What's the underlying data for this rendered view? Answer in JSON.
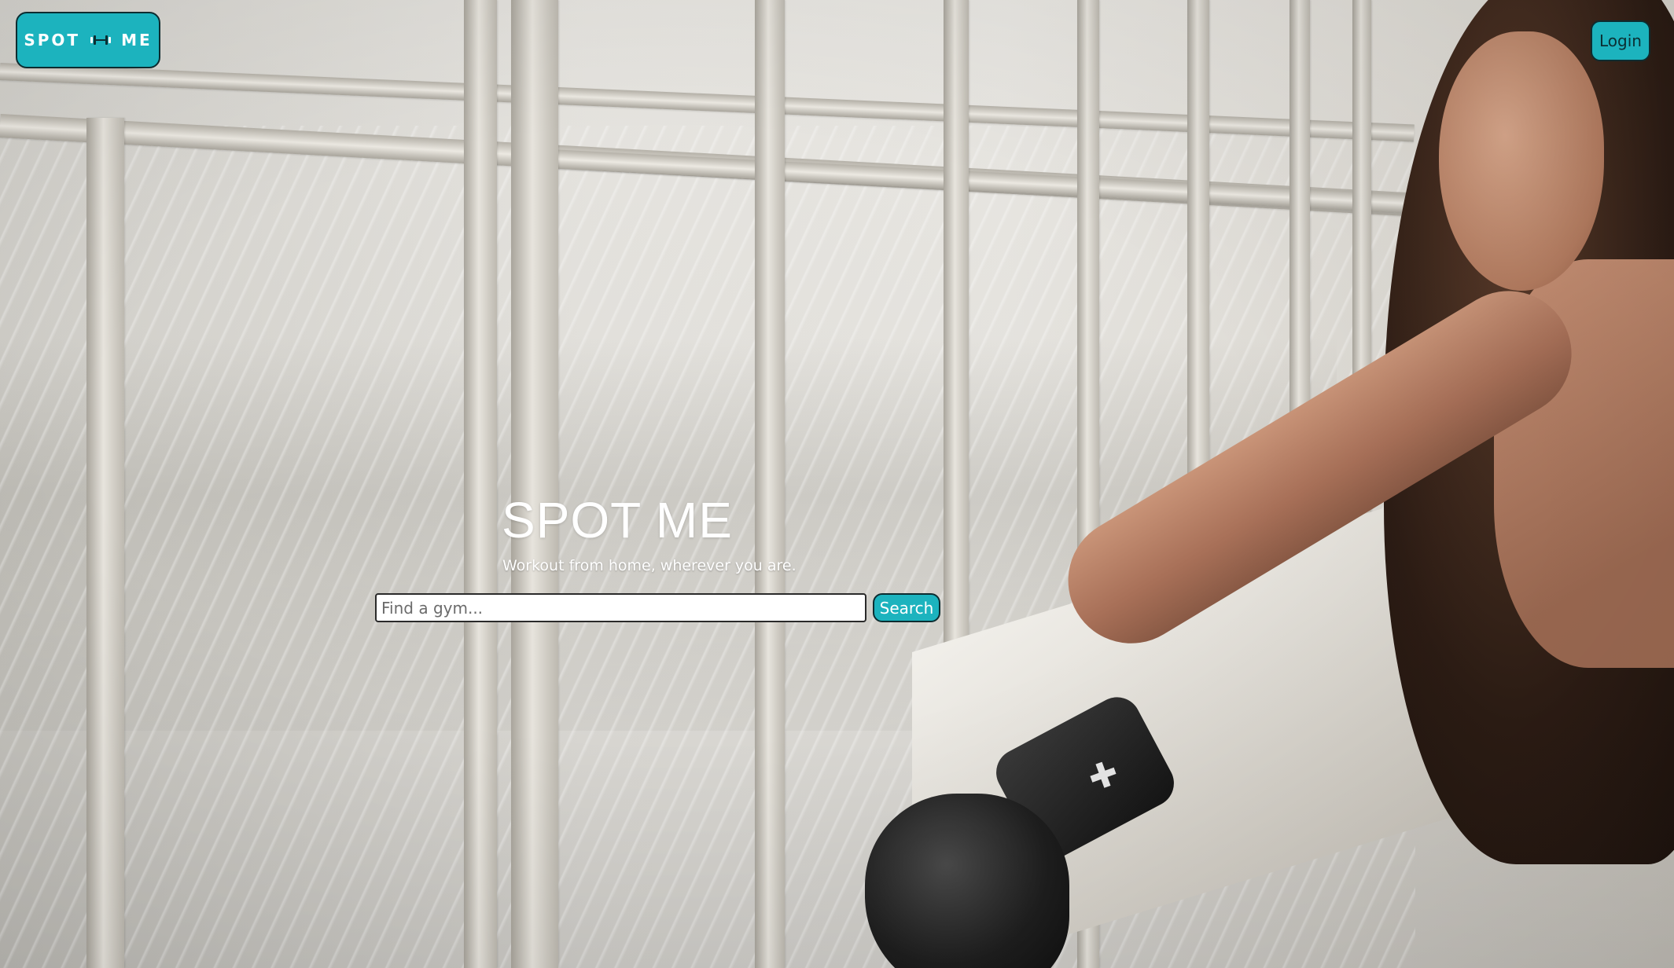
{
  "header": {
    "logo_left": "SPOT",
    "logo_right": "ME",
    "logo_icon": "dumbbell-icon",
    "login_label": "Login"
  },
  "hero": {
    "title": "SPOT ME",
    "subtitle": "Workout from home, wherever you are.",
    "search": {
      "placeholder": "Find a gym...",
      "value": "",
      "button_label": "Search"
    }
  },
  "colors": {
    "accent": "#1cb3be",
    "border": "#0d2c30",
    "text_light": "#ffffff"
  }
}
